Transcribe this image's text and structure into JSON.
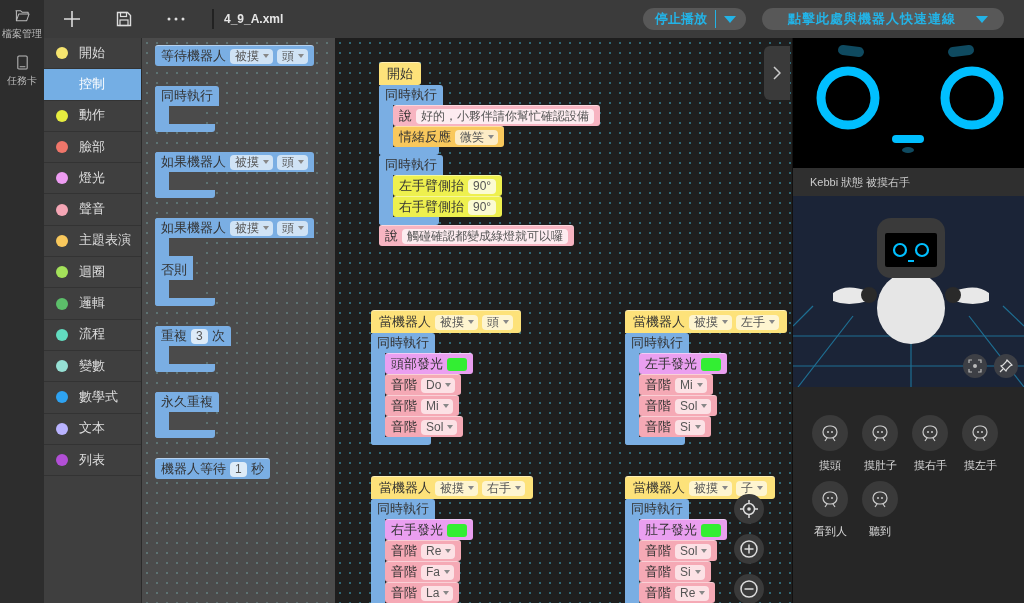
{
  "sidebar": {
    "items": [
      {
        "label": "檔案管理"
      },
      {
        "label": "任務卡"
      }
    ]
  },
  "toolbar": {
    "filename": "4_9_A.xml",
    "stop_button": {
      "label": "停止播放"
    },
    "connect_button": {
      "label": "點擊此處與機器人快速連線"
    }
  },
  "categories": [
    {
      "label": "開始",
      "color": "#f6e56f",
      "selected": false
    },
    {
      "label": "控制",
      "color": "#74aee4",
      "selected": true
    },
    {
      "label": "動作",
      "color": "#e6ec3f",
      "selected": false
    },
    {
      "label": "臉部",
      "color": "#f0766a",
      "selected": false
    },
    {
      "label": "燈光",
      "color": "#ee9cf2",
      "selected": false
    },
    {
      "label": "聲音",
      "color": "#f5a6b5",
      "selected": false
    },
    {
      "label": "主題表演",
      "color": "#f9c85c",
      "selected": false
    },
    {
      "label": "迴圈",
      "color": "#a4e25a",
      "selected": false
    },
    {
      "label": "邏輯",
      "color": "#5cbf6a",
      "selected": false
    },
    {
      "label": "流程",
      "color": "#62dcc0",
      "selected": false
    },
    {
      "label": "變數",
      "color": "#96e0d4",
      "selected": false
    },
    {
      "label": "數學式",
      "color": "#2ea3f2",
      "selected": false
    },
    {
      "label": "文本",
      "color": "#b9b3ff",
      "selected": false
    },
    {
      "label": "列表",
      "color": "#b24fd6",
      "selected": false
    }
  ],
  "flyout": {
    "blocks": [
      {
        "kind": "statement",
        "color": "#7aaee3",
        "parts": [
          {
            "kind": "text",
            "text": "等待機器人"
          },
          {
            "kind": "dropdown",
            "text": "被摸"
          },
          {
            "kind": "dropdown",
            "text": "頭"
          }
        ]
      },
      {
        "kind": "c",
        "color": "#7aaee3",
        "parts": [
          {
            "kind": "text",
            "text": "同時執行"
          }
        ]
      },
      {
        "kind": "c",
        "color": "#7aaee3",
        "parts": [
          {
            "kind": "text",
            "text": "如果機器人"
          },
          {
            "kind": "dropdown",
            "text": "被摸"
          },
          {
            "kind": "dropdown",
            "text": "頭"
          }
        ]
      },
      {
        "kind": "c_else",
        "color": "#7aaee3",
        "parts": [
          {
            "kind": "text",
            "text": "如果機器人"
          },
          {
            "kind": "dropdown",
            "text": "被摸"
          },
          {
            "kind": "dropdown",
            "text": "頭"
          }
        ],
        "else_label": "否則"
      },
      {
        "kind": "c",
        "color": "#7aaee3",
        "parts": [
          {
            "kind": "text",
            "text": "重複"
          },
          {
            "kind": "input",
            "text": "3"
          },
          {
            "kind": "text",
            "text": "次"
          }
        ]
      },
      {
        "kind": "c",
        "color": "#7aaee3",
        "parts": [
          {
            "kind": "text",
            "text": "永久重複"
          }
        ]
      },
      {
        "kind": "statement",
        "color": "#7aaee3",
        "parts": [
          {
            "kind": "text",
            "text": "機器人等待"
          },
          {
            "kind": "input",
            "text": "1"
          },
          {
            "kind": "text",
            "text": "秒"
          }
        ]
      }
    ]
  },
  "workspace": {
    "stacks": [
      {
        "blocks": [
          {
            "kind": "hat",
            "color": "#fde27a",
            "parts": [
              {
                "kind": "text",
                "text": "開始"
              }
            ]
          },
          {
            "kind": "c",
            "color": "#7aaee3",
            "parts": [
              {
                "kind": "text",
                "text": "同時執行"
              }
            ],
            "children": [
              {
                "kind": "statement",
                "color": "#f7b4c1",
                "parts": [
                  {
                    "kind": "text",
                    "text": "說"
                  },
                  {
                    "kind": "input",
                    "text": "好的，小夥伴請你幫忙確認設備"
                  }
                ]
              },
              {
                "kind": "statement",
                "color": "#f9c85c",
                "parts": [
                  {
                    "kind": "text",
                    "text": "情緒反應"
                  },
                  {
                    "kind": "dropdown",
                    "text": "微笑"
                  }
                ]
              }
            ]
          },
          {
            "kind": "c",
            "color": "#7aaee3",
            "parts": [
              {
                "kind": "text",
                "text": "同時執行"
              }
            ],
            "children": [
              {
                "kind": "statement",
                "color": "#eef04e",
                "parts": [
                  {
                    "kind": "text",
                    "text": "左手臂側抬"
                  },
                  {
                    "kind": "input",
                    "text": "90°"
                  }
                ]
              },
              {
                "kind": "statement",
                "color": "#eef04e",
                "parts": [
                  {
                    "kind": "text",
                    "text": "右手臂側抬"
                  },
                  {
                    "kind": "input",
                    "text": "90°"
                  }
                ]
              }
            ]
          },
          {
            "kind": "statement",
            "color": "#f7b4c1",
            "parts": [
              {
                "kind": "text",
                "text": "說"
              },
              {
                "kind": "input",
                "text": "觸碰確認都變成綠燈就可以囉"
              }
            ]
          }
        ]
      },
      {
        "blocks": [
          {
            "kind": "hat",
            "color": "#fde27a",
            "parts": [
              {
                "kind": "text",
                "text": "當機器人"
              },
              {
                "kind": "dropdown",
                "text": "被摸"
              },
              {
                "kind": "dropdown",
                "text": "頭"
              }
            ]
          },
          {
            "kind": "c",
            "color": "#7aaee3",
            "parts": [
              {
                "kind": "text",
                "text": "同時執行"
              }
            ],
            "children": [
              {
                "kind": "statement",
                "color": "#ea9ff0",
                "parts": [
                  {
                    "kind": "text",
                    "text": "頭部發光"
                  },
                  {
                    "kind": "color",
                    "color": "#33ee33"
                  }
                ]
              },
              {
                "kind": "statement",
                "color": "#f5a9b5",
                "parts": [
                  {
                    "kind": "text",
                    "text": "音階"
                  },
                  {
                    "kind": "dropdown",
                    "text": "Do"
                  }
                ]
              },
              {
                "kind": "statement",
                "color": "#f5a9b5",
                "parts": [
                  {
                    "kind": "text",
                    "text": "音階"
                  },
                  {
                    "kind": "dropdown",
                    "text": "Mi"
                  }
                ]
              },
              {
                "kind": "statement",
                "color": "#f5a9b5",
                "parts": [
                  {
                    "kind": "text",
                    "text": "音階"
                  },
                  {
                    "kind": "dropdown",
                    "text": "Sol"
                  }
                ]
              }
            ]
          }
        ]
      },
      {
        "blocks": [
          {
            "kind": "hat",
            "color": "#fde27a",
            "parts": [
              {
                "kind": "text",
                "text": "當機器人"
              },
              {
                "kind": "dropdown",
                "text": "被摸"
              },
              {
                "kind": "dropdown",
                "text": "左手"
              }
            ]
          },
          {
            "kind": "c",
            "color": "#7aaee3",
            "parts": [
              {
                "kind": "text",
                "text": "同時執行"
              }
            ],
            "children": [
              {
                "kind": "statement",
                "color": "#ea9ff0",
                "parts": [
                  {
                    "kind": "text",
                    "text": "左手發光"
                  },
                  {
                    "kind": "color",
                    "color": "#33ee33"
                  }
                ]
              },
              {
                "kind": "statement",
                "color": "#f5a9b5",
                "parts": [
                  {
                    "kind": "text",
                    "text": "音階"
                  },
                  {
                    "kind": "dropdown",
                    "text": "Mi"
                  }
                ]
              },
              {
                "kind": "statement",
                "color": "#f5a9b5",
                "parts": [
                  {
                    "kind": "text",
                    "text": "音階"
                  },
                  {
                    "kind": "dropdown",
                    "text": "Sol"
                  }
                ]
              },
              {
                "kind": "statement",
                "color": "#f5a9b5",
                "parts": [
                  {
                    "kind": "text",
                    "text": "音階"
                  },
                  {
                    "kind": "dropdown",
                    "text": "Si"
                  }
                ]
              }
            ]
          }
        ]
      },
      {
        "blocks": [
          {
            "kind": "hat",
            "color": "#fde27a",
            "parts": [
              {
                "kind": "text",
                "text": "當機器人"
              },
              {
                "kind": "dropdown",
                "text": "被摸"
              },
              {
                "kind": "dropdown",
                "text": "右手"
              }
            ]
          },
          {
            "kind": "c",
            "color": "#7aaee3",
            "parts": [
              {
                "kind": "text",
                "text": "同時執行"
              }
            ],
            "children": [
              {
                "kind": "statement",
                "color": "#ea9ff0",
                "parts": [
                  {
                    "kind": "text",
                    "text": "右手發光"
                  },
                  {
                    "kind": "color",
                    "color": "#33ee33"
                  }
                ]
              },
              {
                "kind": "statement",
                "color": "#f5a9b5",
                "parts": [
                  {
                    "kind": "text",
                    "text": "音階"
                  },
                  {
                    "kind": "dropdown",
                    "text": "Re"
                  }
                ]
              },
              {
                "kind": "statement",
                "color": "#f5a9b5",
                "parts": [
                  {
                    "kind": "text",
                    "text": "音階"
                  },
                  {
                    "kind": "dropdown",
                    "text": "Fa"
                  }
                ]
              },
              {
                "kind": "statement",
                "color": "#f5a9b5",
                "parts": [
                  {
                    "kind": "text",
                    "text": "音階"
                  },
                  {
                    "kind": "dropdown",
                    "text": "La"
                  }
                ]
              }
            ]
          }
        ]
      },
      {
        "blocks": [
          {
            "kind": "hat",
            "color": "#fde27a",
            "parts": [
              {
                "kind": "text",
                "text": "當機器人"
              },
              {
                "kind": "dropdown",
                "text": "被摸"
              },
              {
                "kind": "dropdown",
                "text": "子"
              }
            ]
          },
          {
            "kind": "c",
            "color": "#7aaee3",
            "parts": [
              {
                "kind": "text",
                "text": "同時執行"
              }
            ],
            "children": [
              {
                "kind": "statement",
                "color": "#ea9ff0",
                "parts": [
                  {
                    "kind": "text",
                    "text": "肚子發光"
                  },
                  {
                    "kind": "color",
                    "color": "#33ee33"
                  }
                ]
              },
              {
                "kind": "statement",
                "color": "#f5a9b5",
                "parts": [
                  {
                    "kind": "text",
                    "text": "音階"
                  },
                  {
                    "kind": "dropdown",
                    "text": "Sol"
                  }
                ]
              },
              {
                "kind": "statement",
                "color": "#f5a9b5",
                "parts": [
                  {
                    "kind": "text",
                    "text": "音階"
                  },
                  {
                    "kind": "dropdown",
                    "text": "Si"
                  }
                ]
              },
              {
                "kind": "statement",
                "color": "#f5a9b5",
                "parts": [
                  {
                    "kind": "text",
                    "text": "音階"
                  },
                  {
                    "kind": "dropdown",
                    "text": "Re"
                  }
                ]
              }
            ]
          }
        ]
      }
    ]
  },
  "robot_panel": {
    "status": "Kebbi 狀態 被摸右手",
    "sensors": [
      {
        "label": "摸頭"
      },
      {
        "label": "摸肚子"
      },
      {
        "label": "摸右手"
      },
      {
        "label": "摸左手"
      },
      {
        "label": "看到人"
      },
      {
        "label": "聽到"
      }
    ]
  }
}
